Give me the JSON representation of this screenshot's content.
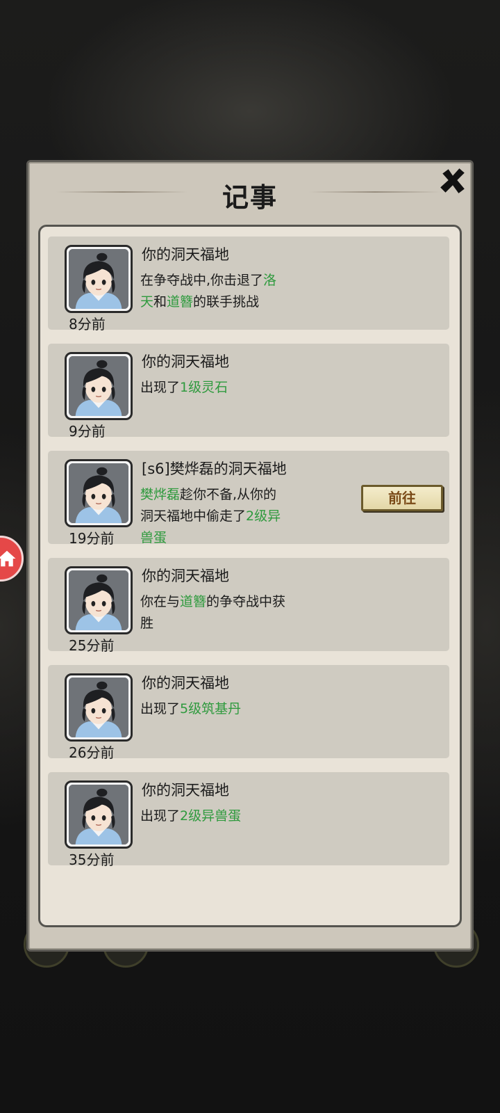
{
  "modal": {
    "title": "记事"
  },
  "goto_label": "前往",
  "entries": [
    {
      "title": "你的洞天福地",
      "body": [
        {
          "t": "在争夺战中,你击退了"
        },
        {
          "t": "洛",
          "hl": true
        },
        {
          "br": true
        },
        {
          "t": "天",
          "hl": true
        },
        {
          "t": "和"
        },
        {
          "t": "道簪",
          "hl": true
        },
        {
          "t": "的联手挑战"
        }
      ],
      "time": "8分前",
      "has_goto": false
    },
    {
      "title": "你的洞天福地",
      "body": [
        {
          "t": "出现了"
        },
        {
          "t": "1级灵石",
          "hl": true
        }
      ],
      "time": "9分前",
      "has_goto": false
    },
    {
      "title": "[s6]樊烨磊的洞天福地",
      "body": [
        {
          "t": "樊烨磊",
          "hl": true
        },
        {
          "t": "趁你不备,从你的"
        },
        {
          "br": true
        },
        {
          "t": "洞天福地中偷走了"
        },
        {
          "t": "2级异",
          "hl": true
        },
        {
          "br": true
        },
        {
          "t": "兽蛋",
          "hl": true
        }
      ],
      "time": "19分前",
      "has_goto": true
    },
    {
      "title": "你的洞天福地",
      "body": [
        {
          "t": "你在与"
        },
        {
          "t": "道簪",
          "hl": true
        },
        {
          "t": "的争夺战中获"
        },
        {
          "br": true
        },
        {
          "t": "胜"
        }
      ],
      "time": "25分前",
      "has_goto": false
    },
    {
      "title": "你的洞天福地",
      "body": [
        {
          "t": "出现了"
        },
        {
          "t": "5级筑基丹",
          "hl": true
        }
      ],
      "time": "26分前",
      "has_goto": false
    },
    {
      "title": "你的洞天福地",
      "body": [
        {
          "t": "出现了"
        },
        {
          "t": "2级异兽蛋",
          "hl": true
        }
      ],
      "time": "35分前",
      "has_goto": false
    }
  ],
  "colors": {
    "highlight": "#2f9a3e",
    "panel": "#cdc7bb",
    "entry": "#cfcbc1"
  },
  "icons": {
    "close": "close-x-icon",
    "home": "home-icon",
    "avatar": "character-portrait"
  }
}
